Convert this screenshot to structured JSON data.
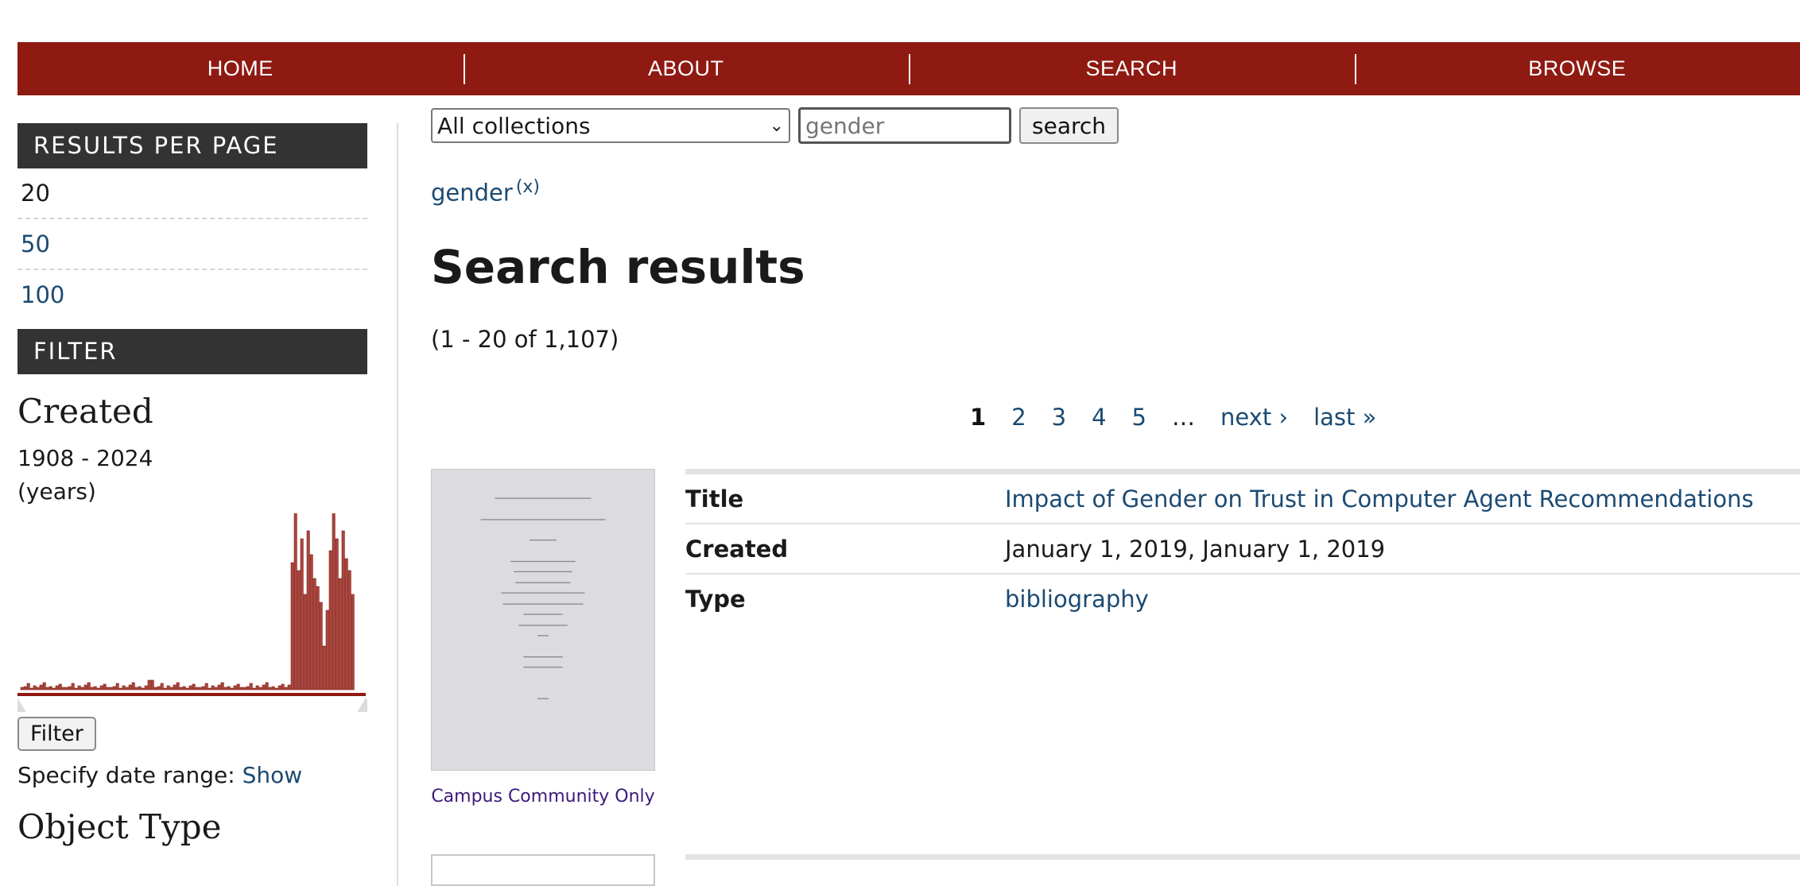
{
  "nav": {
    "items": [
      {
        "label": "HOME"
      },
      {
        "label": "ABOUT"
      },
      {
        "label": "SEARCH"
      },
      {
        "label": "BROWSE"
      }
    ]
  },
  "sidebar": {
    "results_per_page_header": "RESULTS PER PAGE",
    "rpp_options": [
      "20",
      "50",
      "100"
    ],
    "rpp_selected": "20",
    "filter_header": "FILTER",
    "created_title": "Created",
    "created_range": "1908 - 2024",
    "created_unit": "(years)",
    "filter_button": "Filter",
    "date_range_label": "Specify date range:",
    "date_range_link": "Show",
    "object_type_title": "Object Type",
    "histogram_color": "#8e1a12"
  },
  "search": {
    "collection_selected": "All collections",
    "query_placeholder": "gender",
    "button_label": "search"
  },
  "active_facet": {
    "label": "gender",
    "remove_label": "(x)"
  },
  "main": {
    "title": "Search results",
    "count": "(1 - 20 of 1,107)"
  },
  "pager": {
    "current": "1",
    "pages": [
      "2",
      "3",
      "4",
      "5"
    ],
    "ellipsis": "…",
    "next": "next ›",
    "last": "last »"
  },
  "results": [
    {
      "access_label": "Campus Community Only",
      "fields": [
        {
          "label": "Title",
          "value": "Impact of Gender on Trust in Computer Agent Recommendations",
          "link": true
        },
        {
          "label": "Created",
          "value": "January 1, 2019, January 1, 2019",
          "link": false
        },
        {
          "label": "Type",
          "value": "bibliography",
          "link": true
        }
      ]
    }
  ],
  "colors": {
    "nav_bg": "#8e1a12",
    "sidebar_header_bg": "#333333",
    "link": "#1b4a72"
  }
}
